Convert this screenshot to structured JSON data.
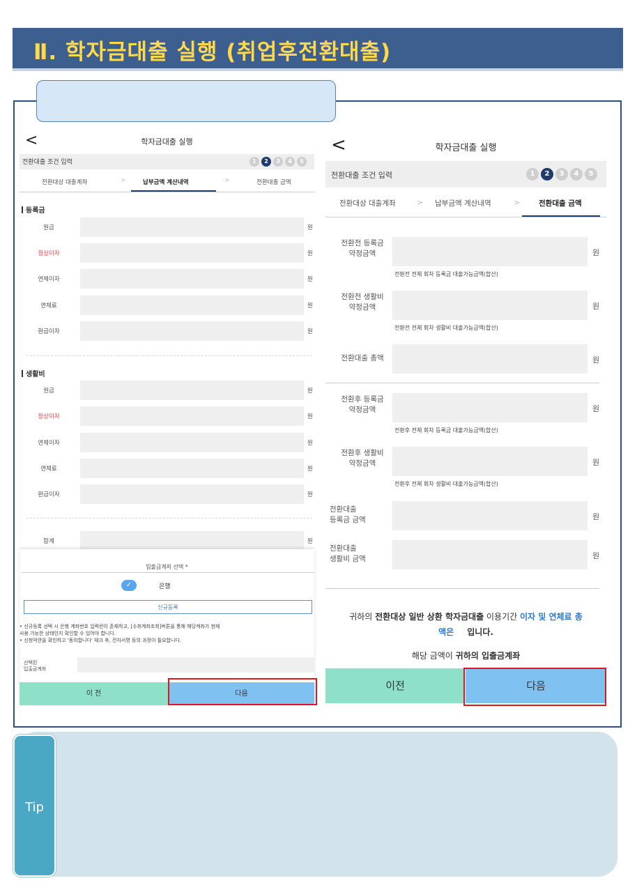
{
  "banner": {
    "title": "Ⅱ. 학자금대출 실행 (취업후전환대출)"
  },
  "left": {
    "title": "학자금대출 실행",
    "back_icon": "<",
    "step_label": "전환대출 조건 입력",
    "steps": [
      "1",
      "2",
      "3",
      "4",
      "5"
    ],
    "active_step": 2,
    "tabs": [
      "전환대상 대출계좌",
      "납부금액 계산내역",
      "전환대출 금액"
    ],
    "tab_sep": ">",
    "section1": "등록금",
    "section2": "생활비",
    "fields": [
      "원금",
      "정상이자",
      "연체이자",
      "연체료",
      "환급이자"
    ],
    "unit": "원",
    "total_label": "합계",
    "modal": {
      "title": "입출금계좌 선택 *",
      "check": "✓",
      "bank": "은행",
      "new_button": "신규등록",
      "note1": "• 신규등록 선택 시 은행 계좌번호 입력란이 존재하고, [수취계좌조회]버튼을 통해 해당계좌가 현재",
      "note2": "  사용 가능한 상태인지 확인할 수 있어야 합니다.",
      "note3": "• 신청약관을 확인하고 '동의합니다' 체크 후, 전자서명 등의 과정이 필요합니다.",
      "selected_label_1": "선택된",
      "selected_label_2": "입출금계좌",
      "prev": "이 전",
      "next": "다음"
    }
  },
  "right": {
    "title": "학자금대출 실행",
    "back_icon": "<",
    "step_label": "전환대출 조건 입력",
    "steps": [
      "1",
      "2",
      "3",
      "4",
      "5"
    ],
    "active_step": 2,
    "tabs": [
      "전환대상 대출계좌",
      "납부금액 계산내역",
      "전환대출 금액"
    ],
    "tab_sep": ">",
    "unit": "원",
    "rows": [
      {
        "l1": "전환전 등록금",
        "l2": "약정금액",
        "sub": "전환전 전체 회차 등록금 대출가능금액(합산)"
      },
      {
        "l1": "전환전 생활비",
        "l2": "약정금액",
        "sub": "전환전 전체 회차 생활비 대출가능금액(합산)"
      },
      {
        "l1": "전환대출 총액",
        "l2": "",
        "sub": ""
      },
      {
        "l1": "전환후 등록금",
        "l2": "약정금액",
        "sub": "전환후 전체 회차 등록금 대출가능금액(합산)"
      },
      {
        "l1": "전환후 생활비",
        "l2": "약정금액",
        "sub": "전환후 전체 회차 생활비 대출가능금액(합산)"
      },
      {
        "l1": "전환대출",
        "l2": "등록금 금액",
        "sub": ""
      },
      {
        "l1": "전환대출",
        "l2": "생활비 금액",
        "sub": ""
      }
    ],
    "msg": {
      "a": "귀하의 ",
      "b": "전환대상 일반 상환 학자금대출",
      "c": " 이용기간 ",
      "d": "이자 및 연체료 총",
      "e": "액은",
      "f": "입니다.",
      "g": "해당 금액이 ",
      "h": "귀하의 입출금계좌"
    },
    "prev": "이전",
    "next": "다음"
  },
  "tip": {
    "label": "Tip"
  },
  "colors": {
    "banner": "#3d5f8f",
    "banner_text": "#ffd94a",
    "prev_btn": "#8fe0c9",
    "next_btn": "#7fc2f2",
    "highlight": "#e0161e"
  }
}
